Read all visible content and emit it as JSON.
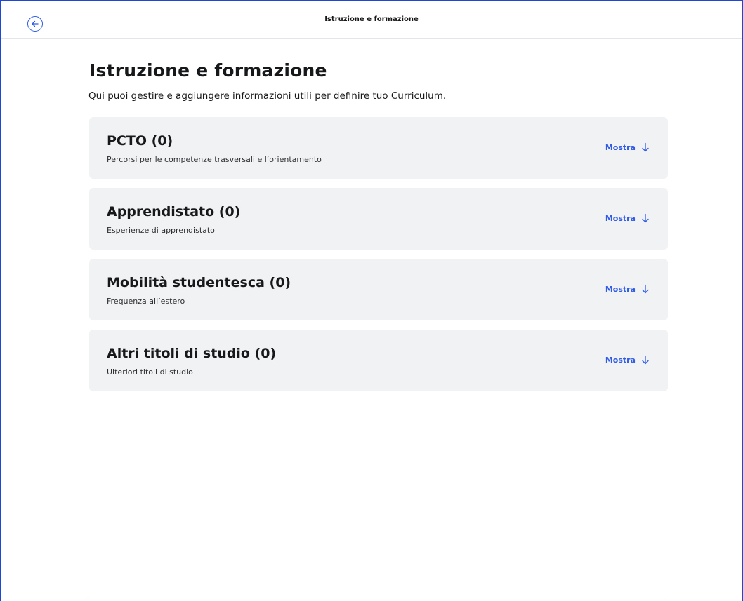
{
  "header": {
    "title": "Istruzione e formazione",
    "back_icon": "arrow-left-circle-icon"
  },
  "main": {
    "title": "Istruzione e formazione",
    "subtitle": "Qui puoi gestire e aggiungere informazioni utili per definire tuo Curriculum."
  },
  "sections": [
    {
      "title": "PCTO (0)",
      "description": "Percorsi per le competenze trasversali e l’orientamento",
      "action_label": "Mostra"
    },
    {
      "title": "Apprendistato (0)",
      "description": "Esperienze di apprendistato",
      "action_label": "Mostra"
    },
    {
      "title": "Mobilità studentesca (0)",
      "description": "Frequenza all’estero",
      "action_label": "Mostra"
    },
    {
      "title": "Altri titoli di studio (0)",
      "description": "Ulteriori titoli di studio",
      "action_label": "Mostra"
    }
  ],
  "colors": {
    "accent": "#2f5be6",
    "card_background": "#f1f2f4",
    "frame_border": "#1f47d6"
  }
}
